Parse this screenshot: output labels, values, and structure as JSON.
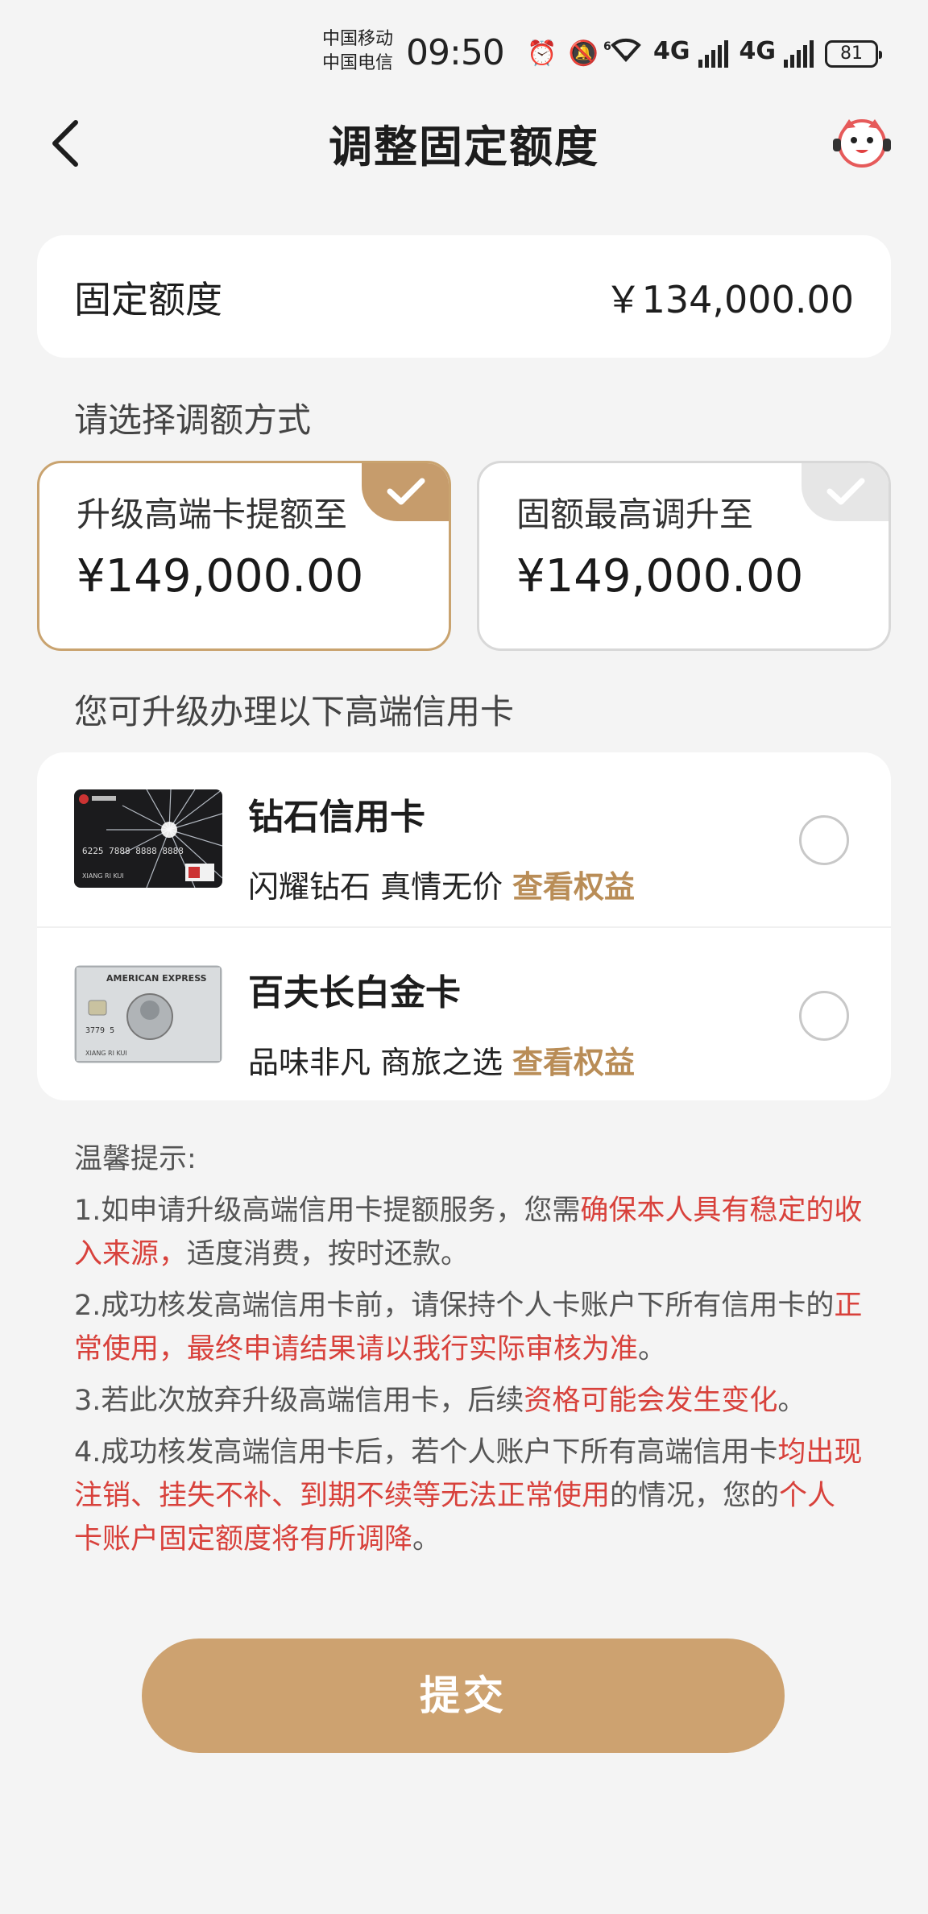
{
  "status_bar": {
    "carrier1": "中国移动",
    "carrier2": "中国电信",
    "time": "09:50",
    "network1": "4G",
    "network2": "4G",
    "wifi_badge": "6",
    "battery": "81"
  },
  "nav": {
    "title": "调整固定额度"
  },
  "fixed_limit": {
    "label": "固定额度",
    "value": "￥134,000.00"
  },
  "select_method_label": "请选择调额方式",
  "options": [
    {
      "label": "升级高端卡提额至",
      "amount": "¥149,000.00",
      "selected": true
    },
    {
      "label": "固额最高调升至",
      "amount": "¥149,000.00",
      "selected": false
    }
  ],
  "upgrade_label": "您可升级办理以下高端信用卡",
  "cards": [
    {
      "name": "钻石信用卡",
      "desc": "闪耀钻石 真情无价",
      "link": "查看权益"
    },
    {
      "name": "百夫长白金卡",
      "desc": "品味非凡 商旅之选",
      "link": "查看权益"
    }
  ],
  "card_images": {
    "diamond_number": "6225 7888 8888 8888",
    "diamond_holder": "XIANG RI KUI",
    "amex_brand": "AMERICAN EXPRESS",
    "amex_number": "3779 5",
    "amex_holder": "XIANG RI KUI"
  },
  "tips": {
    "title": "温馨提示:",
    "items": [
      {
        "a": "1.如申请升级高端信用卡提额服务，您需",
        "b": "确保本人具有稳定的收入来源，",
        "c": "适度消费，按时还款。"
      },
      {
        "a": "2.成功核发高端信用卡前，请保持个人卡账户下所有信用卡的",
        "b": "正常使用，最终申请结果请以我行实际审核为准",
        "c": "。"
      },
      {
        "a": "3.若此次放弃升级高端信用卡，后续",
        "b": "资格可能会发生变化",
        "c": "。"
      },
      {
        "a": "4.成功核发高端信用卡后，若个人账户下所有高端信用卡",
        "b": "均出现注销、挂失不补、到期不续等无法正常使用",
        "c": "的情况，您的",
        "d": "个人卡账户固定额度将有所调降",
        "e": "。"
      }
    ]
  },
  "submit_label": "提交",
  "colors": {
    "accent": "#c69c6c",
    "warning_red": "#d8413b",
    "link_gold": "#b98d57"
  }
}
